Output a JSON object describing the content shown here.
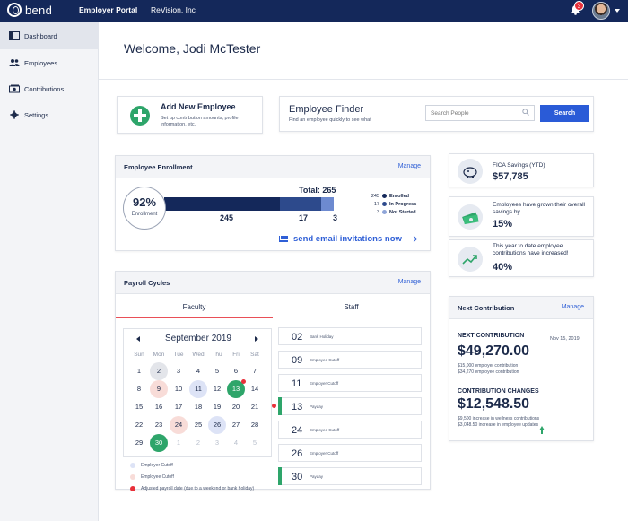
{
  "topbar": {
    "logo_text": "bend",
    "portal_label": "Employer Portal",
    "company": "ReVision, Inc",
    "notification_count": "3"
  },
  "sidebar": {
    "items": [
      {
        "label": "Dashboard",
        "icon": "dashboard-icon",
        "active": true
      },
      {
        "label": "Employees",
        "icon": "people-icon",
        "active": false
      },
      {
        "label": "Contributions",
        "icon": "money-icon",
        "active": false
      },
      {
        "label": "Settings",
        "icon": "gear-icon",
        "active": false
      }
    ]
  },
  "welcome": "Welcome, Jodi McTester",
  "add_employee": {
    "title": "Add New Employee",
    "description": "Set up contribution amounts, profile information, etc."
  },
  "finder": {
    "title": "Employee Finder",
    "description": "Find an employee quickly to see what",
    "placeholder": "Search People",
    "button": "Search"
  },
  "enrollment": {
    "title": "Employee Enrollment",
    "manage": "Manage",
    "percent": "92%",
    "percent_label": "Enrollment",
    "total_label": "Total: 265",
    "enrolled": 245,
    "in_progress": 17,
    "not_started": 3,
    "legend": [
      {
        "num": "245",
        "label": "Enrolled",
        "color": "#14285a"
      },
      {
        "num": "17",
        "label": "In Progress",
        "color": "#2d4a8c"
      },
      {
        "num": "3",
        "label": "Not Started",
        "color": "#8fa5d8"
      }
    ],
    "bar_labels": {
      "enrolled": "245",
      "in_progress": "17",
      "not_started": "3"
    },
    "send_invites": "send email invitations now"
  },
  "payroll": {
    "title": "Payroll Cycles",
    "manage": "Manage",
    "tabs": [
      "Faculty",
      "Staff"
    ],
    "calendar": {
      "month": "September 2019",
      "weekdays": [
        "Sun",
        "Mon",
        "Tue",
        "Wed",
        "Thu",
        "Fri",
        "Sat"
      ]
    },
    "legend": [
      {
        "label": "Employer Cutoff",
        "color": "#dde3f6"
      },
      {
        "label": "Employee Cutoff",
        "color": "#f8dcd8"
      },
      {
        "label": "Adjusted payroll date (due to a weekend or bank holiday)",
        "color": "#e8303a"
      }
    ],
    "list": [
      {
        "date": "02",
        "desc": "Bank Holiday",
        "accent": false,
        "reddot": false
      },
      {
        "date": "09",
        "desc": "Employee Cutoff",
        "accent": false,
        "reddot": false
      },
      {
        "date": "11",
        "desc": "Employer Cutoff",
        "accent": false,
        "reddot": false
      },
      {
        "date": "13",
        "desc": "Payday",
        "accent": true,
        "reddot": true
      },
      {
        "date": "24",
        "desc": "Employee Cutoff",
        "accent": false,
        "reddot": false
      },
      {
        "date": "26",
        "desc": "Employer Cutoff",
        "accent": false,
        "reddot": false
      },
      {
        "date": "30",
        "desc": "Payday",
        "accent": true,
        "reddot": false
      }
    ]
  },
  "stats": {
    "fica": {
      "label": "FICA Savings (YTD)",
      "value": "$57,785",
      "icon": "piggy-bank-icon"
    },
    "savings": {
      "label": "Employees have grown their overall savings by",
      "value": "15%",
      "icon": "cash-stack-icon"
    },
    "contrib": {
      "label": "This year to date employee contributions have increased!",
      "value": "40%",
      "icon": "trend-up-icon"
    }
  },
  "next_contribution": {
    "title": "Next Contribution",
    "manage": "Manage",
    "heading": "NEXT CONTRIBUTION",
    "date": "Nov 15, 2019",
    "amount": "$49,270.00",
    "details": [
      "$15,000 employer contribution",
      "$34,270 employee contribution"
    ],
    "changes_heading": "CONTRIBUTION CHANGES",
    "changes_amount": "$12,548.50",
    "changes_details": [
      "$9,500 increase in wellness contributions",
      "$3,048.50 increase in employee updates"
    ]
  }
}
